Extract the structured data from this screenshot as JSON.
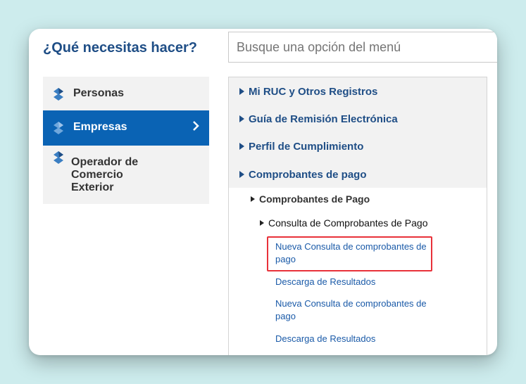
{
  "header": {
    "title": "¿Qué necesitas hacer?",
    "search_placeholder": "Busque una opción del menú"
  },
  "sidebar": {
    "items": [
      {
        "label": "Personas",
        "icon": "sunat-logo-icon",
        "selected": false
      },
      {
        "label": "Empresas",
        "icon": "sunat-logo-icon",
        "selected": true
      },
      {
        "label": "Operador de Comercio Exterior",
        "icon": "sunat-logo-icon",
        "selected": false
      }
    ]
  },
  "menu": {
    "level1": [
      "Mi RUC y Otros Registros",
      "Guía de Remisión Electrónica",
      "Perfil de Cumplimiento",
      "Comprobantes de pago"
    ],
    "level2": "Comprobantes de Pago",
    "level3": "Consulta de Comprobantes de Pago",
    "leaves": [
      "Nueva Consulta de comprobantes de pago",
      "Descarga de Resultados",
      "Nueva Consulta de comprobantes de pago",
      "Descarga de Resultados"
    ],
    "highlighted_leaf_index": 0
  },
  "colors": {
    "background": "#cdeced",
    "brand_blue": "#1f4e86",
    "selected_bg": "#0a63b4",
    "link_blue": "#1a5aa8",
    "highlight_red": "#e8313a"
  }
}
